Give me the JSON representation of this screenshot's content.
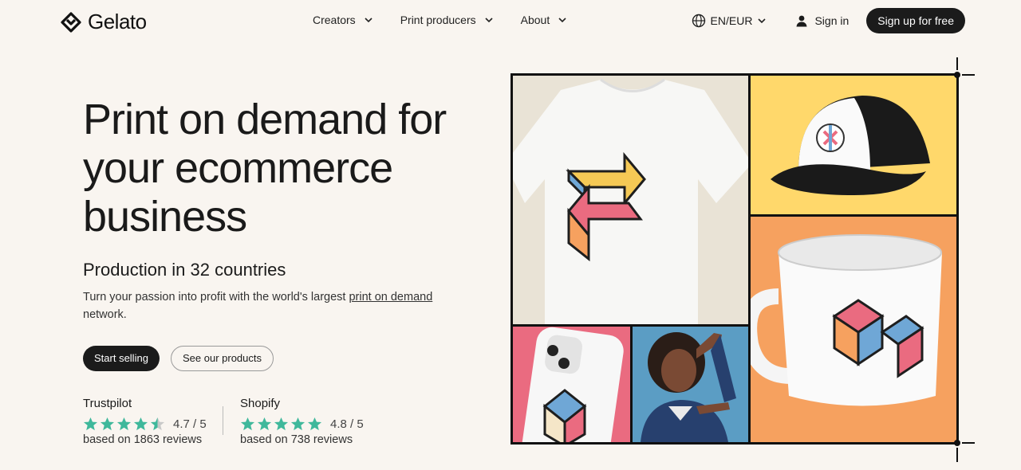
{
  "brand": {
    "name": "Gelato"
  },
  "nav": {
    "items": [
      {
        "label": "Creators"
      },
      {
        "label": "Print producers"
      },
      {
        "label": "About"
      }
    ],
    "language": "EN/EUR",
    "signin": "Sign in",
    "signup": "Sign up for free"
  },
  "hero": {
    "title": "Print on demand for your ecommerce business",
    "subhead": "Production in 32 countries",
    "desc_before": "Turn your passion into profit with the world's largest ",
    "desc_link": "print on demand",
    "desc_after": " network.",
    "primary_cta": "Start selling",
    "secondary_cta": "See our products"
  },
  "ratings": [
    {
      "source": "Trustpilot",
      "score": "4.7 / 5",
      "reviews": "based on 1863 reviews",
      "stars": 4.5
    },
    {
      "source": "Shopify",
      "score": "4.8 / 5",
      "reviews": "based on 738 reviews",
      "stars": 5
    }
  ],
  "colors": {
    "background": "#f9f5f0",
    "dark": "#1b1b1b",
    "star": "#3fb89b",
    "yellow": "#ffd86b",
    "orange": "#f6a15f",
    "pink": "#ea6b80",
    "blue": "#5b9dc4"
  },
  "icons": [
    "gelato-logo-icon",
    "chevron-down-icon",
    "globe-icon",
    "user-icon",
    "star-icon"
  ]
}
